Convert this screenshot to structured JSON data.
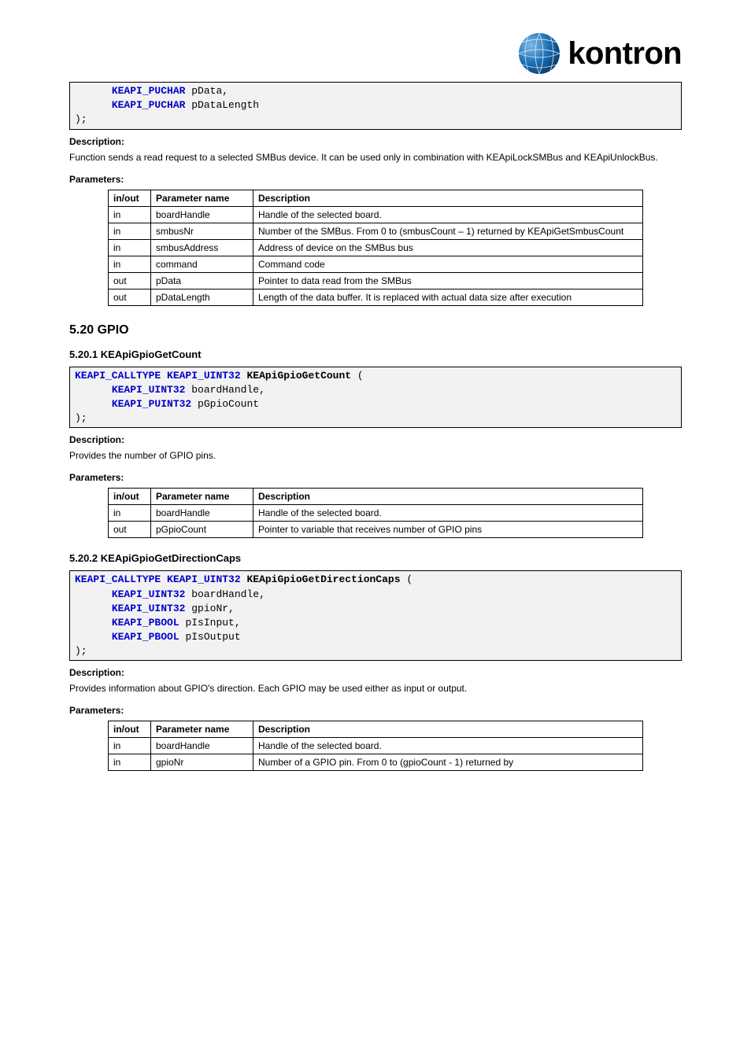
{
  "logo_text": "kontron",
  "codebox0": {
    "l1_t": "KEAPI_PUCHAR",
    "l1_v": "pData,",
    "l2_t": "KEAPI_PUCHAR",
    "l2_v": "pDataLength",
    "l3": ");"
  },
  "desc0_label": "Description:",
  "desc0_text": "Function sends a read request to a selected SMBus device. It can be used only in combination with KEApiLockSMBus and KEApiUnlockBus.",
  "params0_label": "Parameters:",
  "params0_headers": {
    "a": "in/out",
    "b": "Parameter name",
    "c": "Description"
  },
  "params0_rows": [
    {
      "a": "in",
      "b": "boardHandle",
      "c": "Handle of the selected board."
    },
    {
      "a": "in",
      "b": "smbusNr",
      "c": "Number of the SMBus. From 0 to (smbusCount – 1) returned by KEApiGetSmbusCount"
    },
    {
      "a": "in",
      "b": "smbusAddress",
      "c": "Address of device on the SMBus bus"
    },
    {
      "a": "in",
      "b": "command",
      "c": "Command code"
    },
    {
      "a": "out",
      "b": "pData",
      "c": "Pointer to data read from the SMBus"
    },
    {
      "a": "out",
      "b": "pDataLength",
      "c": "Length of the data buffer. It is replaced with actual data size after execution"
    }
  ],
  "sec1_hdr": "5.20 GPIO",
  "sub1_hdr": "5.20.1 KEApiGpioGetCount",
  "codebox1": {
    "kw1": "KEAPI_CALLTYPE",
    "kw2": "KEAPI_UINT32",
    "fn": "KEApiGpioGetCount",
    "open": "(",
    "p1_t": "KEAPI_UINT32",
    "p1_v": "boardHandle,",
    "p2_t": "KEAPI_PUINT32",
    "p2_v": "pGpioCount",
    "close": ");"
  },
  "desc1_label": "Description:",
  "desc1_text": "Provides the number of GPIO pins.",
  "params1_label": "Parameters:",
  "params1_headers": {
    "a": "in/out",
    "b": "Parameter name",
    "c": "Description"
  },
  "params1_rows": [
    {
      "a": "in",
      "b": "boardHandle",
      "c": "Handle of the selected board."
    },
    {
      "a": "out",
      "b": "pGpioCount",
      "c": "Pointer to variable that receives number of GPIO pins"
    }
  ],
  "sub2_hdr": "5.20.2 KEApiGpioGetDirectionCaps",
  "codebox2": {
    "kw1": "KEAPI_CALLTYPE",
    "kw2": "KEAPI_UINT32",
    "fn": "KEApiGpioGetDirectionCaps",
    "open": "(",
    "p1_t": "KEAPI_UINT32",
    "p1_v": "boardHandle,",
    "p2_t": "KEAPI_UINT32",
    "p2_v": "gpioNr,",
    "p3_t": "KEAPI_PBOOL",
    "p3_v": "pIsInput,",
    "p4_t": "KEAPI_PBOOL",
    "p4_v": "pIsOutput",
    "close": ");"
  },
  "desc2_label": "Description:",
  "desc2_text": "Provides information about GPIO's direction. Each GPIO may be used either as input or output.",
  "params2_label": "Parameters:",
  "params2_headers": {
    "a": "in/out",
    "b": "Parameter name",
    "c": "Description"
  },
  "params2_rows": [
    {
      "a": "in",
      "b": "boardHandle",
      "c": "Handle of the selected board."
    },
    {
      "a": "in",
      "b": "gpioNr",
      "c": "Number of a GPIO pin. From 0 to (gpioCount - 1) returned by"
    }
  ]
}
